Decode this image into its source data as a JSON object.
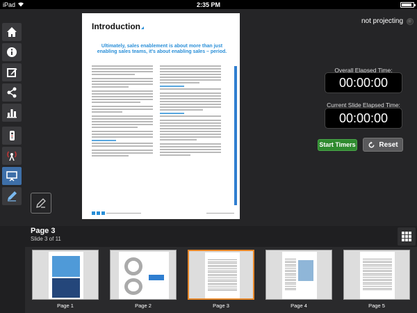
{
  "status_bar": {
    "device": "iPad",
    "time": "2:35 PM"
  },
  "projection": {
    "status_text": "not projecting"
  },
  "sidebar": {
    "items": [
      {
        "icon": "home-icon"
      },
      {
        "icon": "info-icon"
      },
      {
        "icon": "edit-icon"
      },
      {
        "icon": "share-icon"
      },
      {
        "icon": "bar-chart-icon"
      },
      {
        "icon": "remote-icon"
      },
      {
        "icon": "broadcast-icon"
      },
      {
        "icon": "presentation-icon",
        "active": true
      },
      {
        "icon": "pen-icon"
      }
    ]
  },
  "slide": {
    "title": "Introduction",
    "headline": "Ultimately, sales enablement is about more than just enabling sales teams, it's about enabling sales – period."
  },
  "timers": {
    "overall_label": "Overall Elapsed Time:",
    "overall_value": "00:00:00",
    "current_label": "Current Slide Elapsed Time:",
    "current_value": "00:00:00",
    "start_label": "Start Timers",
    "reset_label": "Reset"
  },
  "page_info": {
    "title": "Page 3",
    "subtitle": "Slide 3 of 11"
  },
  "thumbnails": [
    {
      "label": "Page 1"
    },
    {
      "label": "Page 2"
    },
    {
      "label": "Page 3",
      "selected": true
    },
    {
      "label": "Page 4"
    },
    {
      "label": "Page 5"
    }
  ],
  "colors": {
    "accent": "#2a8fd8",
    "selected_border": "#e8882a",
    "start_green": "#2f8a2f",
    "sidebar_active": "#3e6fa8"
  }
}
